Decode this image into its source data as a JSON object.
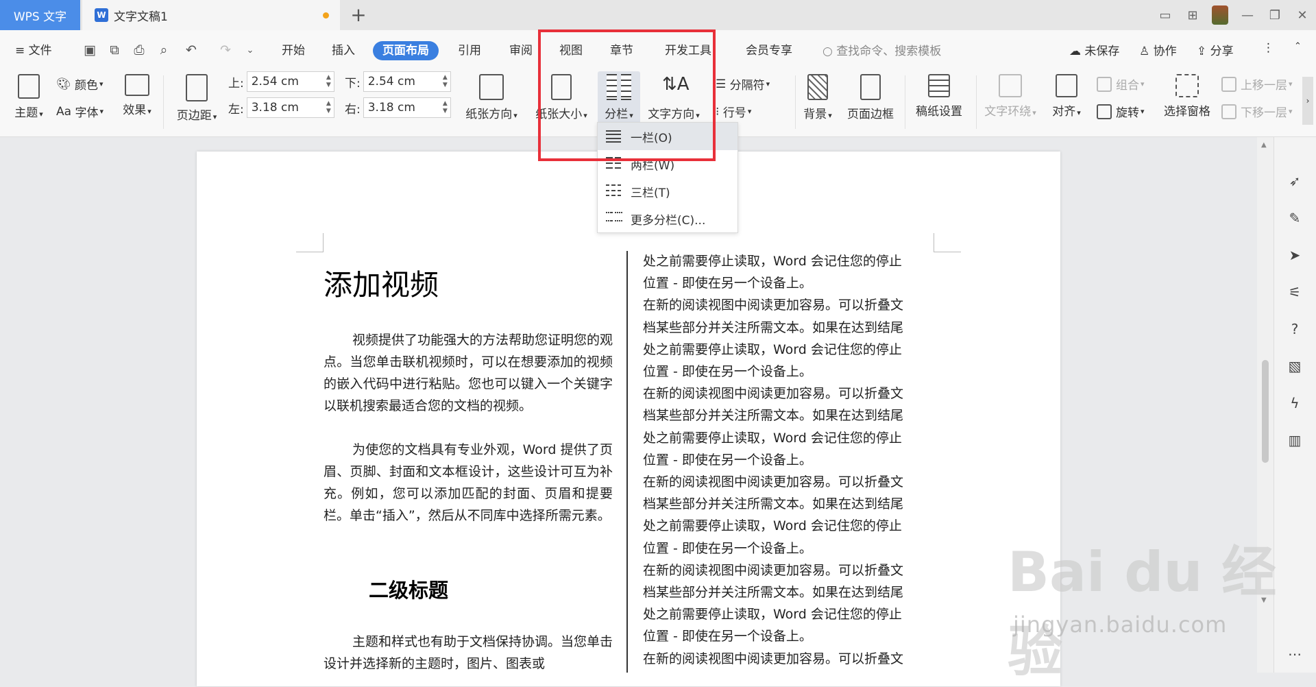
{
  "titlebar": {
    "app_tab": "WPS 文字",
    "doc_tab": "文字文稿1",
    "new_tab": "+"
  },
  "menu": {
    "file": "文件",
    "tabs": [
      "开始",
      "插入",
      "页面布局",
      "引用",
      "审阅",
      "视图",
      "章节",
      "开发工具",
      "会员专享"
    ],
    "active_tab": "页面布局",
    "search_placeholder": "查找命令、搜索模板",
    "unsaved": "未保存",
    "collaborate": "协作",
    "share": "分享"
  },
  "ribbon": {
    "theme": "主题",
    "color": "颜色",
    "font": "字体",
    "effect": "效果",
    "margins": "页边距",
    "top_label": "上:",
    "top_value": "2.54 cm",
    "bottom_label": "下:",
    "bottom_value": "2.54 cm",
    "left_label": "左:",
    "left_value": "3.18 cm",
    "right_label": "右:",
    "right_value": "3.18 cm",
    "orientation": "纸张方向",
    "paper_size": "纸张大小",
    "columns": "分栏",
    "text_direction": "文字方向",
    "breaks": "分隔符",
    "line_numbers": "行号",
    "background": "背景",
    "page_border": "页面边框",
    "manuscript": "稿纸设置",
    "text_wrap": "文字环绕",
    "align": "对齐",
    "group": "组合",
    "rotate": "旋转",
    "selection_pane": "选择窗格",
    "bring_forward": "上移一层",
    "send_backward": "下移一层"
  },
  "columns_dropdown": {
    "items": [
      "一栏(O)",
      "两栏(W)",
      "三栏(T)",
      "更多分栏(C)..."
    ],
    "highlighted": "一栏(O)"
  },
  "document": {
    "title": "添加视频",
    "para1": "视频提供了功能强大的方法帮助您证明您的观点。当您单击联机视频时，可以在想要添加的视频的嵌入代码中进行粘贴。您也可以键入一个关键字以联机搜索最适合您的文档的视频。",
    "para2": "为使您的文档具有专业外观，Word 提供了页眉、页脚、封面和文本框设计，这些设计可互为补充。例如，您可以添加匹配的封面、页眉和提要栏。单击“插入”，然后从不同库中选择所需元素。",
    "heading2": "二级标题",
    "para3": "主题和样式也有助于文档保持协调。当您单击设计并选择新的主题时，图片、图表或",
    "right_lines": [
      "处之前需要停止读取，Word 会记住您的停止",
      "位置 - 即使在另一个设备上。",
      "在新的阅读视图中阅读更加容易。可以折叠文",
      "档某些部分并关注所需文本。如果在达到结尾",
      "处之前需要停止读取，Word 会记住您的停止",
      "位置 - 即使在另一个设备上。",
      "在新的阅读视图中阅读更加容易。可以折叠文",
      "档某些部分并关注所需文本。如果在达到结尾",
      "处之前需要停止读取，Word 会记住您的停止",
      "位置 - 即使在另一个设备上。",
      "在新的阅读视图中阅读更加容易。可以折叠文",
      "档某些部分并关注所需文本。如果在达到结尾",
      "处之前需要停止读取，Word 会记住您的停止",
      "位置 - 即使在另一个设备上。",
      "在新的阅读视图中阅读更加容易。可以折叠文",
      "档某些部分并关注所需文本。如果在达到结尾",
      "处之前需要停止读取，Word 会记住您的停止",
      "位置 - 即使在另一个设备上。",
      "在新的阅读视图中阅读更加容易。可以折叠文"
    ]
  },
  "watermark": {
    "brand": "Bai  du 经验",
    "url": "jingyan.baidu.com"
  },
  "colors": {
    "accent": "#3a7fe0",
    "highlight_box": "#e8303a"
  }
}
